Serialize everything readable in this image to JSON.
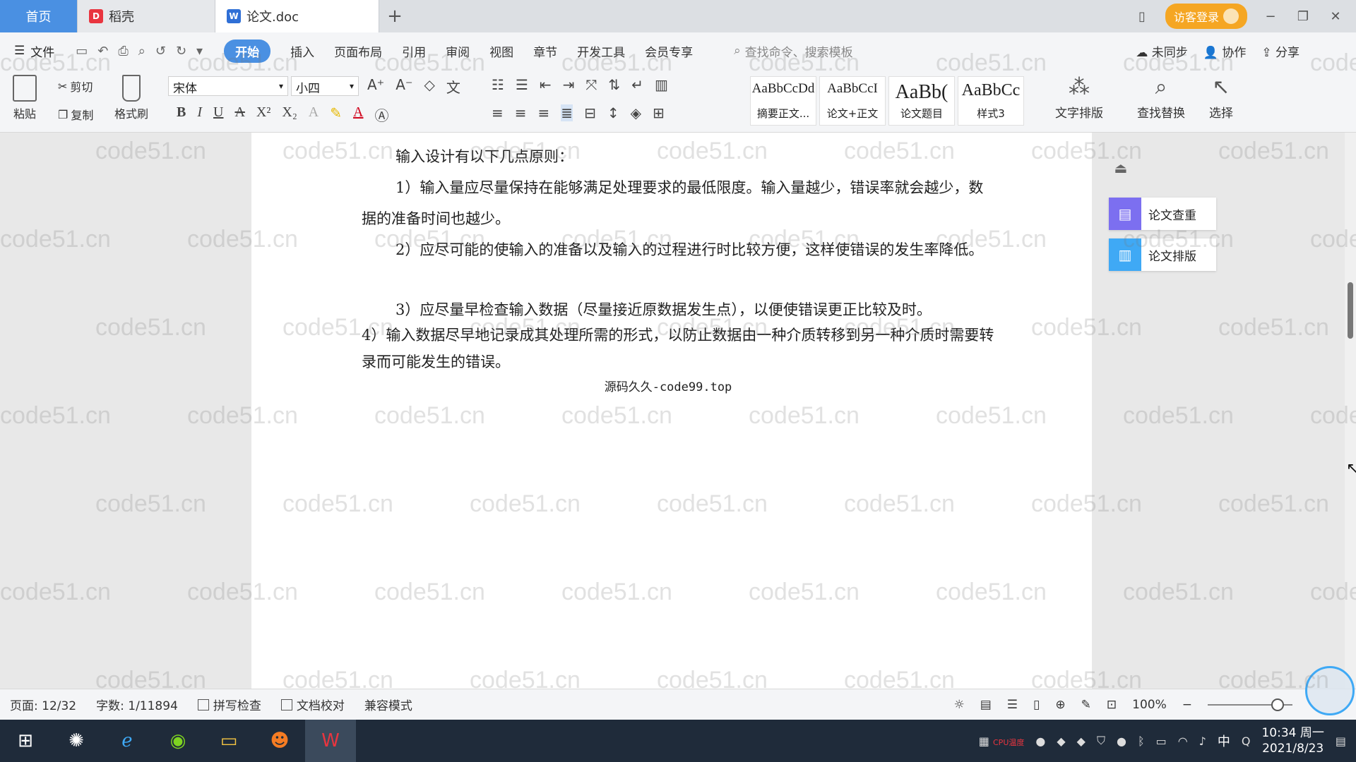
{
  "tabs": {
    "home": "首页",
    "draft": "稻壳",
    "doc": "论文.doc",
    "add": "+"
  },
  "window": {
    "login": "访客登录",
    "minimize": "−",
    "restore": "❐",
    "close": "✕"
  },
  "menu": {
    "file": "文件",
    "items": [
      "开始",
      "插入",
      "页面布局",
      "引用",
      "审阅",
      "视图",
      "章节",
      "开发工具",
      "会员专享"
    ],
    "active_index": 0,
    "search_placeholder": "查找命令、搜索模板",
    "sync": "未同步",
    "collab": "协作",
    "share": "分享"
  },
  "ribbon": {
    "paste": "粘贴",
    "cut": "剪切",
    "copy": "复制",
    "format_painter": "格式刷",
    "font_name": "宋体",
    "font_size": "小四",
    "styles": [
      {
        "sample": "AaBbCcDd",
        "name": "摘要正文..."
      },
      {
        "sample": "AaBbCcI",
        "name": "论文+正文"
      },
      {
        "sample": "AaBb(",
        "name": "论文题目"
      },
      {
        "sample": "AaBbCc",
        "name": "样式3"
      }
    ],
    "text_layout": "文字排版",
    "find_replace": "查找替换",
    "select": "选择"
  },
  "document": {
    "paragraphs": [
      "输入设计有以下几点原则：",
      "1）输入量应尽量保持在能够满足处理要求的最低限度。输入量越少，错误率就会越少，数据的准备时间也越少。",
      "2）应尽可能的使输入的准备以及输入的过程进行时比较方便，这样使错误的发生率降低。",
      "3）应尽量早检查输入数据（尽量接近原数据发生点），以便使错误更正比较及时。",
      "4）输入数据尽早地记录成其处理所需的形式，以防止数据由一种介质转移到另一种介质时需要转录而可能发生的错误。"
    ],
    "caption": "源码久久-code99.top"
  },
  "side_panel": {
    "check": "论文查重",
    "layout": "论文排版"
  },
  "status": {
    "page": "页面: 12/32",
    "words": "字数: 1/11894",
    "spell": "拼写检查",
    "proof": "文档校对",
    "compat": "兼容模式",
    "zoom": "100%"
  },
  "taskbar": {
    "time": "10:34 周一",
    "date": "2021/8/23",
    "ime": "中",
    "cpu": "CPU温度"
  },
  "watermark": "code51.cn",
  "colors": {
    "accent": "#4a90e2",
    "login": "#f5a623",
    "check_tool": "#7c6ff0",
    "layout_tool": "#3fa9f5",
    "taskbar": "#1f2b3a"
  }
}
